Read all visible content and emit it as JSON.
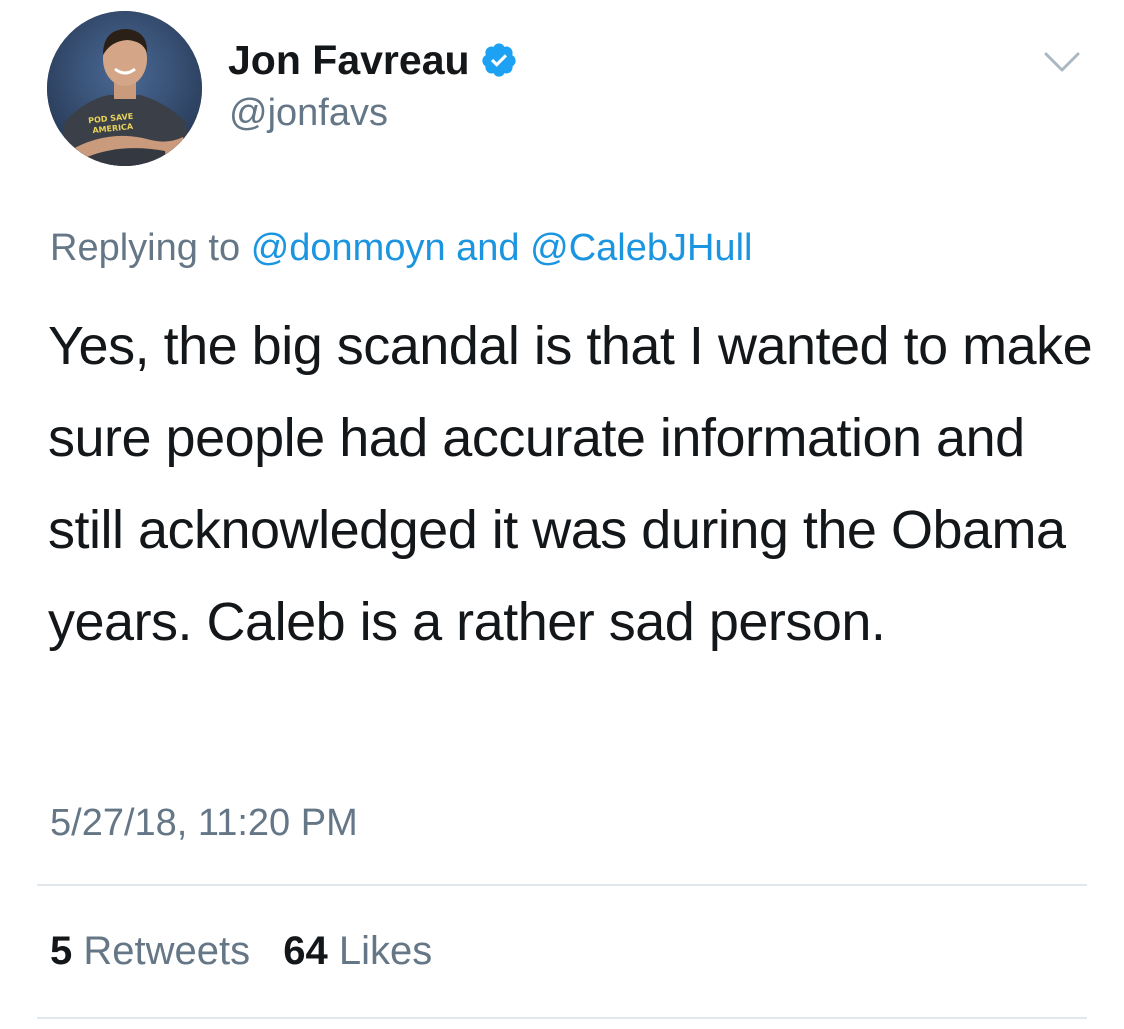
{
  "author": {
    "display_name": "Jon Favreau",
    "handle": "@jonfavs",
    "verified": true,
    "avatar_shirt_text_line1": "POD SAVE",
    "avatar_shirt_text_line2": "AMERICA"
  },
  "reply": {
    "prefix": "Replying to",
    "mention1": "@donmoyn",
    "joiner": "and",
    "mention2": "@CalebJHull"
  },
  "tweet": {
    "text": "Yes, the big scandal is that I wanted to make sure people had accurate information and still acknowledged it was during the Obama years. Caleb is a rather sad person.",
    "timestamp": "5/27/18, 11:20 PM"
  },
  "stats": {
    "retweets_count": "5",
    "retweets_label": "Retweets",
    "likes_count": "64",
    "likes_label": "Likes"
  },
  "icons": {
    "verified": "verified-badge-icon",
    "menu": "chevron-down-icon"
  },
  "colors": {
    "link": "#1b95e0",
    "secondary_text": "#657786",
    "primary_text": "#14171a",
    "divider": "#e1e8ed",
    "verified": "#1da1f2"
  }
}
